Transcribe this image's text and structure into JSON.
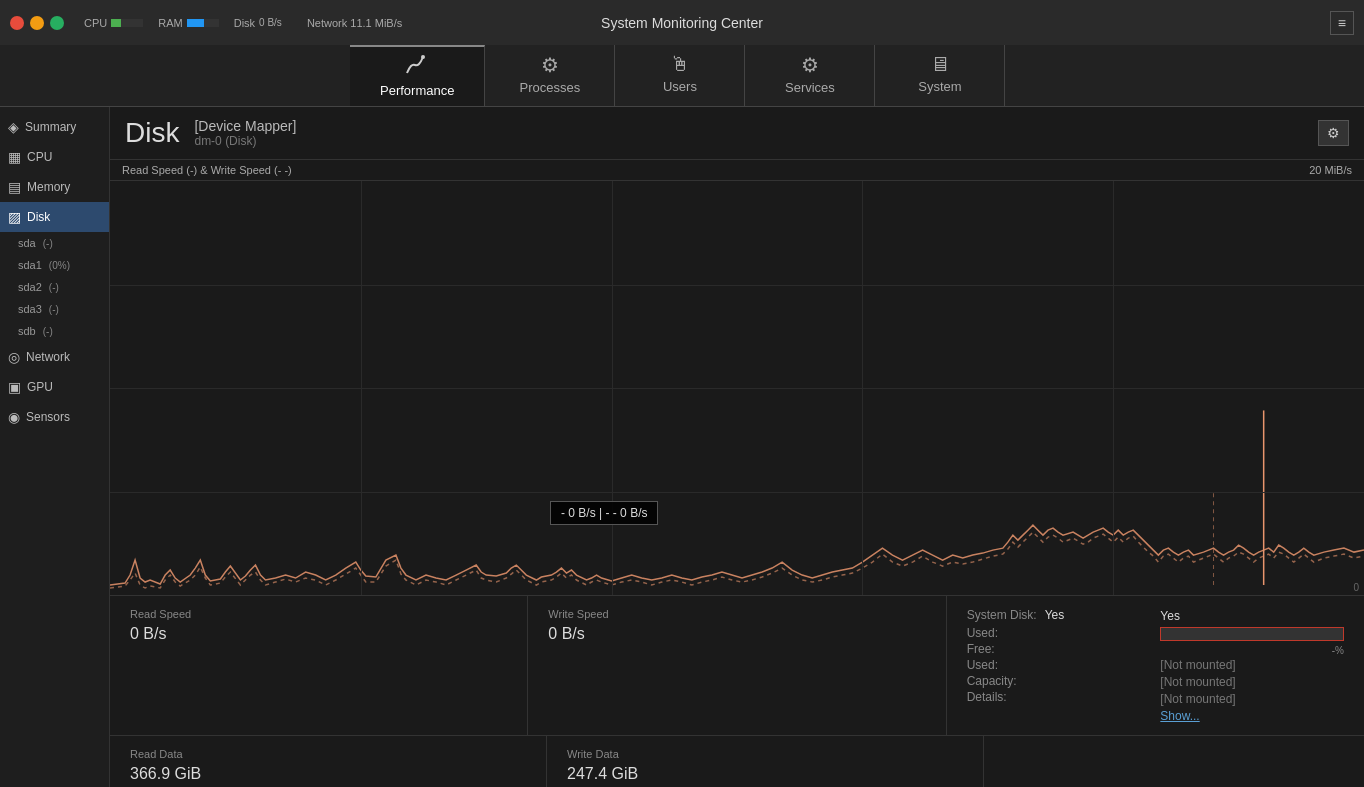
{
  "titlebar": {
    "title": "System Monitoring Center",
    "cpu_label": "CPU",
    "ram_label": "RAM",
    "disk_label": "Disk",
    "cpu_fill": 30,
    "ram_fill": 55,
    "network_label": "Network",
    "network_value": "11.1 MiB/s",
    "disk_value": "0 B/s",
    "menu_icon": "≡"
  },
  "tabs": [
    {
      "id": "performance",
      "label": "Performance",
      "icon": "⟳",
      "active": true
    },
    {
      "id": "processes",
      "label": "Processes",
      "icon": "⚙",
      "active": false
    },
    {
      "id": "users",
      "label": "Users",
      "icon": "🖱",
      "active": false
    },
    {
      "id": "services",
      "label": "Services",
      "icon": "⚙",
      "active": false
    },
    {
      "id": "system",
      "label": "System",
      "icon": "🖥",
      "active": false
    }
  ],
  "sidebar": {
    "items": [
      {
        "id": "summary",
        "label": "Summary",
        "icon": "◈",
        "active": false
      },
      {
        "id": "cpu",
        "label": "CPU",
        "icon": "▦",
        "active": false
      },
      {
        "id": "memory",
        "label": "Memory",
        "icon": "▤",
        "active": false
      },
      {
        "id": "disk",
        "label": "Disk",
        "icon": "▨",
        "active": true
      },
      {
        "id": "network",
        "label": "Network",
        "icon": "◎",
        "active": false
      },
      {
        "id": "gpu",
        "label": "GPU",
        "icon": "▣",
        "active": false
      },
      {
        "id": "sensors",
        "label": "Sensors",
        "icon": "◉",
        "active": false
      }
    ],
    "disk_sub_items": [
      {
        "id": "sda",
        "label": "sda",
        "badge": "(-)",
        "active": false
      },
      {
        "id": "sda1",
        "label": "sda1",
        "badge": "(0%)",
        "active": false
      },
      {
        "id": "sda2",
        "label": "sda2",
        "badge": "(-)",
        "active": false
      },
      {
        "id": "sda3",
        "label": "sda3",
        "badge": "(-)",
        "active": false
      },
      {
        "id": "sdb",
        "label": "sdb",
        "badge": "(-)",
        "active": false
      }
    ]
  },
  "disk": {
    "title": "Disk",
    "device_mapper": "[Device Mapper]",
    "device_id": "dm-0 (Disk)",
    "graph_title_left": "Read Speed (-) & Write Speed (- -)",
    "graph_title_right": "20 MiB/s",
    "y_axis_zero": "0",
    "tooltip_text": "- 0 B/s  |  - - 0 B/s",
    "read_speed_label": "Read Speed",
    "read_speed_value": "0 B/s",
    "write_speed_label": "Write Speed",
    "write_speed_value": "0 B/s",
    "read_data_label": "Read Data",
    "read_data_value": "366.9 GiB",
    "write_data_label": "Write Data",
    "write_data_value": "247.4 GiB",
    "system_disk_label": "System Disk:",
    "system_disk_value": "Yes",
    "used_label": "Used:",
    "used_value": "",
    "free_label": "Free:",
    "free_value": "",
    "used_2_label": "Used:",
    "used_2_value": "",
    "capacity_label": "Capacity:",
    "capacity_value": "",
    "details_label": "Details:",
    "details_value": "",
    "progress_value": "-",
    "progress_suffix": "-%",
    "not_mounted_1": "[Not mounted]",
    "not_mounted_2": "[Not mounted]",
    "not_mounted_3": "[Not mounted]",
    "show_link": "Show..."
  }
}
